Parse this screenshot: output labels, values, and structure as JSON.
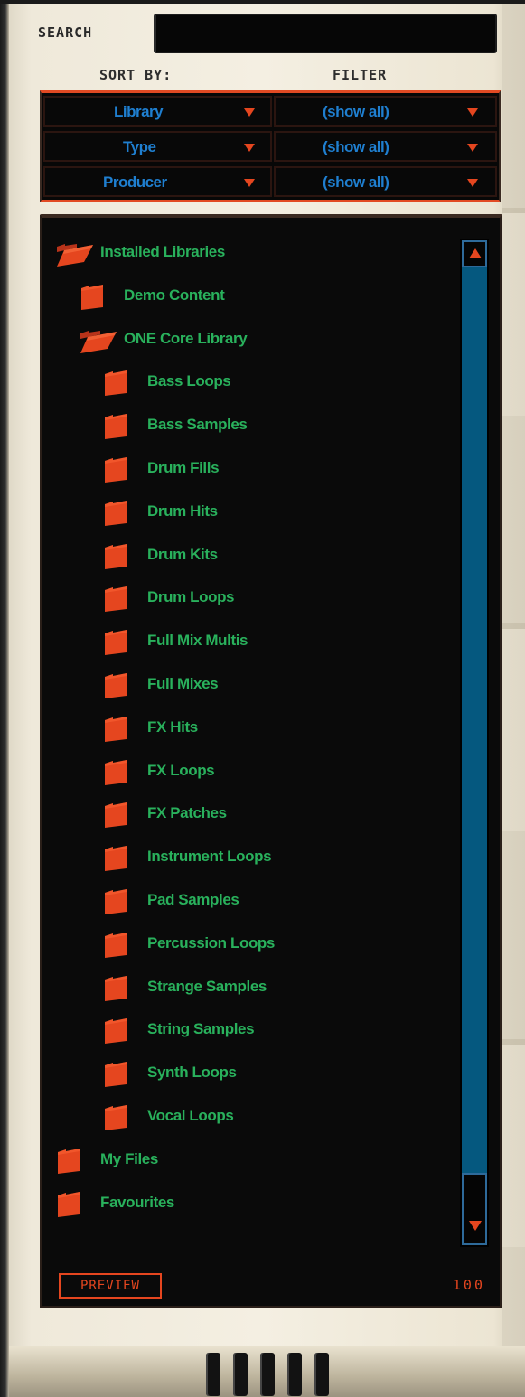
{
  "search": {
    "label": "SEARCH",
    "value": ""
  },
  "headers": {
    "sort_by": "SORT BY:",
    "filter": "FILTER"
  },
  "sort_rows": [
    {
      "sort": "Library",
      "filter": "(show all)"
    },
    {
      "sort": "Type",
      "filter": "(show all)"
    },
    {
      "sort": "Producer",
      "filter": "(show all)"
    }
  ],
  "tree": [
    {
      "label": "Installed Libraries",
      "level": 0,
      "open": true
    },
    {
      "label": "Demo Content",
      "level": 1,
      "open": false
    },
    {
      "label": "ONE Core Library",
      "level": 1,
      "open": true
    },
    {
      "label": "Bass Loops",
      "level": 2,
      "open": false
    },
    {
      "label": "Bass Samples",
      "level": 2,
      "open": false
    },
    {
      "label": "Drum Fills",
      "level": 2,
      "open": false
    },
    {
      "label": "Drum Hits",
      "level": 2,
      "open": false
    },
    {
      "label": "Drum Kits",
      "level": 2,
      "open": false
    },
    {
      "label": "Drum Loops",
      "level": 2,
      "open": false
    },
    {
      "label": "Full Mix Multis",
      "level": 2,
      "open": false
    },
    {
      "label": "Full Mixes",
      "level": 2,
      "open": false
    },
    {
      "label": "FX Hits",
      "level": 2,
      "open": false
    },
    {
      "label": "FX Loops",
      "level": 2,
      "open": false
    },
    {
      "label": "FX Patches",
      "level": 2,
      "open": false
    },
    {
      "label": "Instrument Loops",
      "level": 2,
      "open": false
    },
    {
      "label": "Pad Samples",
      "level": 2,
      "open": false
    },
    {
      "label": "Percussion Loops",
      "level": 2,
      "open": false
    },
    {
      "label": "Strange Samples",
      "level": 2,
      "open": false
    },
    {
      "label": "String Samples",
      "level": 2,
      "open": false
    },
    {
      "label": "Synth Loops",
      "level": 2,
      "open": false
    },
    {
      "label": "Vocal Loops",
      "level": 2,
      "open": false
    },
    {
      "label": "My Files",
      "level": 0,
      "open": false
    },
    {
      "label": "Favourites",
      "level": 0,
      "open": false
    }
  ],
  "footer": {
    "preview_label": "PREVIEW",
    "volume": "100"
  },
  "colors": {
    "accent": "#e5461f",
    "tree_text": "#29b15c",
    "sort_text": "#1f7fd0",
    "scroll_track": "#05587f"
  },
  "icons": {
    "folder_closed": "folder-icon",
    "folder_open": "folder-open-icon",
    "sort_dropdown": "dropdown-arrow-icon"
  }
}
